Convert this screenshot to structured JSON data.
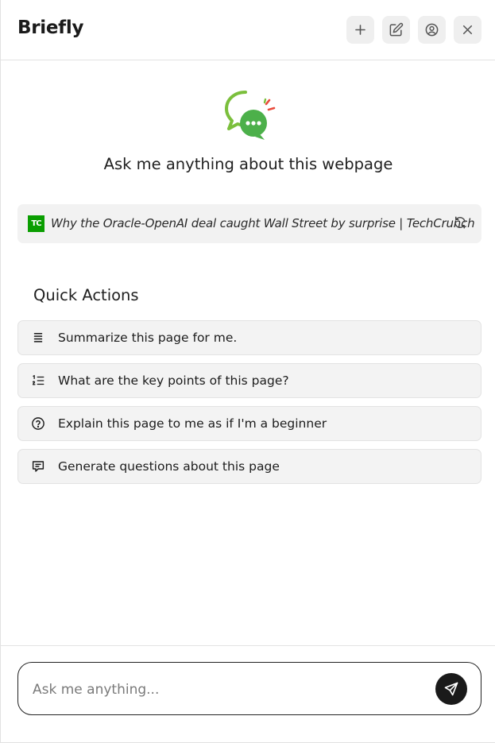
{
  "app": {
    "title": "Briefly"
  },
  "header": {
    "buttons": [
      {
        "name": "new-chat-button",
        "icon": "plus-icon"
      },
      {
        "name": "edit-button",
        "icon": "edit-icon"
      },
      {
        "name": "account-button",
        "icon": "user-circle-icon"
      },
      {
        "name": "close-button",
        "icon": "close-icon"
      }
    ]
  },
  "hero": {
    "title": "Ask me anything about this webpage",
    "logo_icon": "chat-bubble-logo-icon"
  },
  "source": {
    "site_logo_text": "TC",
    "title": "Why the Oracle-OpenAI deal caught Wall Street by surprise | TechCrunch",
    "refresh_icon": "refresh-icon"
  },
  "quick_actions": {
    "title": "Quick Actions",
    "items": [
      {
        "label": "Summarize this page for me.",
        "icon": "list-icon"
      },
      {
        "label": "What are the key points of this page?",
        "icon": "numbered-list-icon"
      },
      {
        "label": "Explain this page to me as if I'm a beginner",
        "icon": "question-circle-icon"
      },
      {
        "label": "Generate questions about this page",
        "icon": "message-square-icon"
      }
    ]
  },
  "chat": {
    "placeholder": "Ask me anything...",
    "value": "",
    "send_icon": "send-icon"
  },
  "colors": {
    "accent": "#1a1a1a",
    "brand_green": "#0a9e01",
    "logo_green": "#5cb85c"
  }
}
